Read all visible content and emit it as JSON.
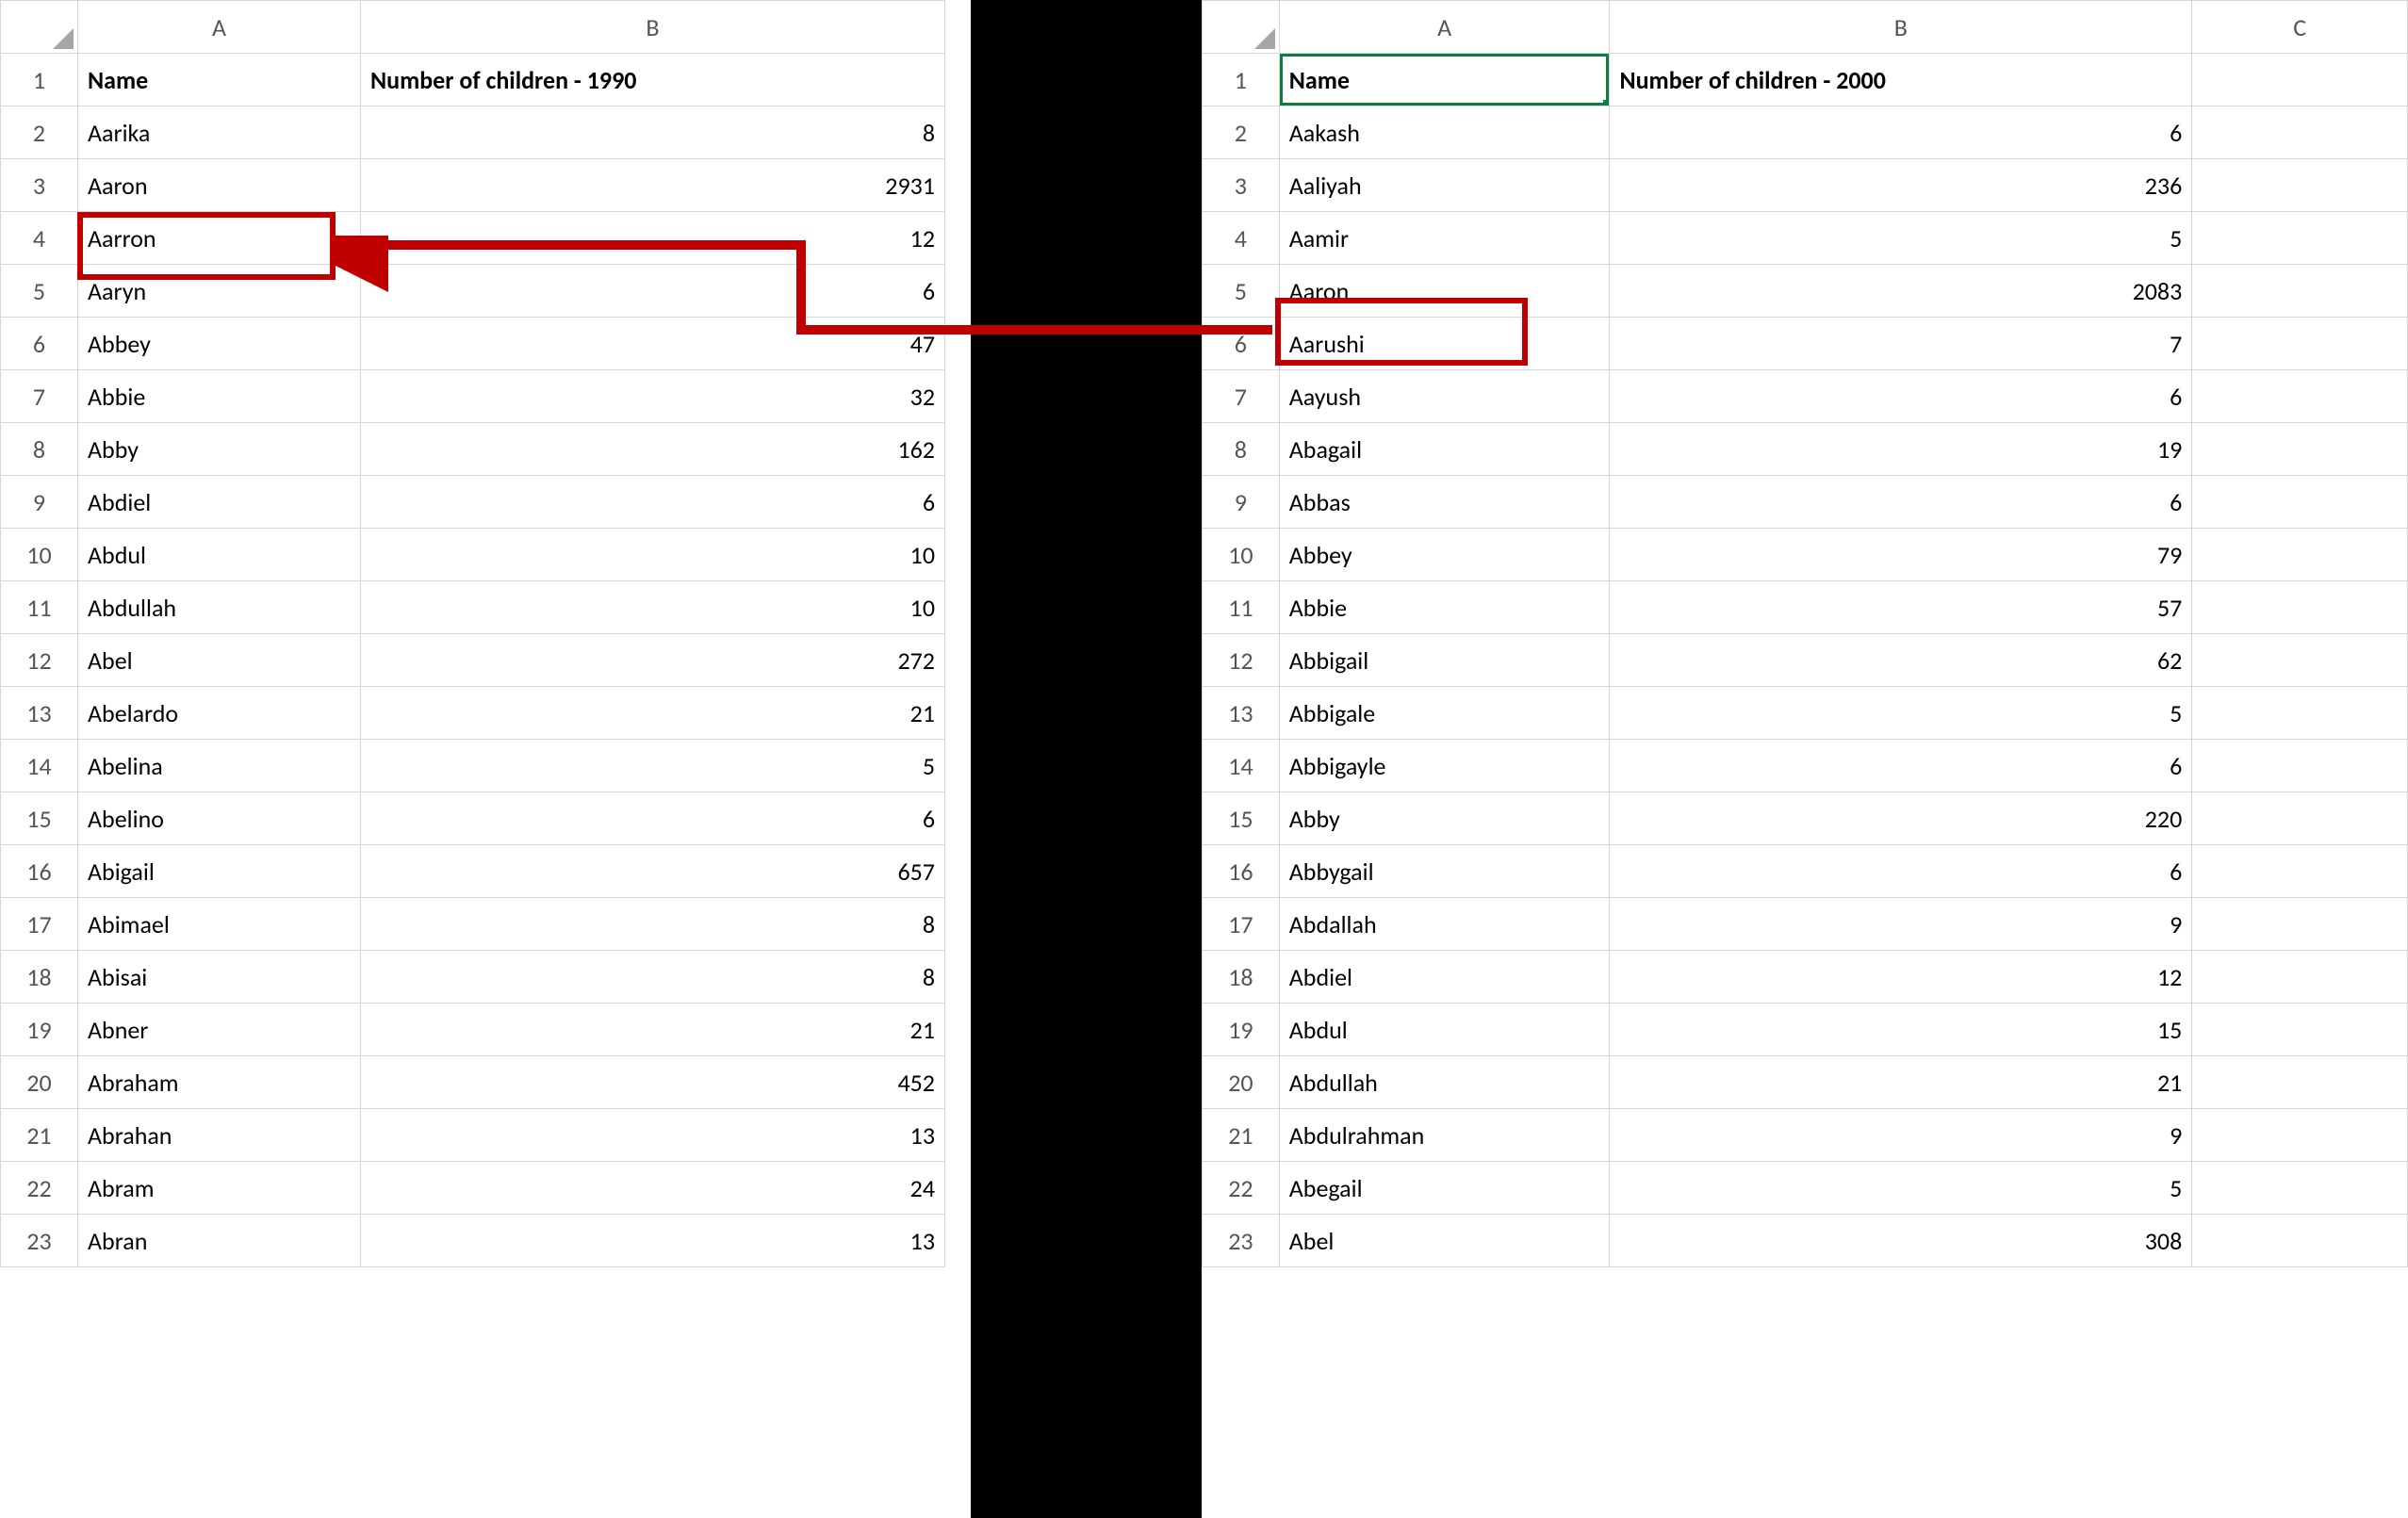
{
  "left": {
    "colLabels": [
      "A",
      "B"
    ],
    "header": {
      "A": "Name",
      "B": "Number of children - 1990"
    },
    "rows": [
      {
        "A": "Aarika",
        "B": "8"
      },
      {
        "A": "Aaron",
        "B": "2931"
      },
      {
        "A": "Aarron",
        "B": "12"
      },
      {
        "A": "Aaryn",
        "B": "6"
      },
      {
        "A": "Abbey",
        "B": "47"
      },
      {
        "A": "Abbie",
        "B": "32"
      },
      {
        "A": "Abby",
        "B": "162"
      },
      {
        "A": "Abdiel",
        "B": "6"
      },
      {
        "A": "Abdul",
        "B": "10"
      },
      {
        "A": "Abdullah",
        "B": "10"
      },
      {
        "A": "Abel",
        "B": "272"
      },
      {
        "A": "Abelardo",
        "B": "21"
      },
      {
        "A": "Abelina",
        "B": "5"
      },
      {
        "A": "Abelino",
        "B": "6"
      },
      {
        "A": "Abigail",
        "B": "657"
      },
      {
        "A": "Abimael",
        "B": "8"
      },
      {
        "A": "Abisai",
        "B": "8"
      },
      {
        "A": "Abner",
        "B": "21"
      },
      {
        "A": "Abraham",
        "B": "452"
      },
      {
        "A": "Abrahan",
        "B": "13"
      },
      {
        "A": "Abram",
        "B": "24"
      },
      {
        "A": "Abran",
        "B": "13"
      }
    ]
  },
  "right": {
    "colLabels": [
      "A",
      "B",
      "C"
    ],
    "header": {
      "A": "Name",
      "B": "Number of children - 2000",
      "C": ""
    },
    "rows": [
      {
        "A": "Aakash",
        "B": "6"
      },
      {
        "A": "Aaliyah",
        "B": "236"
      },
      {
        "A": "Aamir",
        "B": "5"
      },
      {
        "A": "Aaron",
        "B": "2083"
      },
      {
        "A": "Aarushi",
        "B": "7"
      },
      {
        "A": "Aayush",
        "B": "6"
      },
      {
        "A": "Abagail",
        "B": "19"
      },
      {
        "A": "Abbas",
        "B": "6"
      },
      {
        "A": "Abbey",
        "B": "79"
      },
      {
        "A": "Abbie",
        "B": "57"
      },
      {
        "A": "Abbigail",
        "B": "62"
      },
      {
        "A": "Abbigale",
        "B": "5"
      },
      {
        "A": "Abbigayle",
        "B": "6"
      },
      {
        "A": "Abby",
        "B": "220"
      },
      {
        "A": "Abbygail",
        "B": "6"
      },
      {
        "A": "Abdallah",
        "B": "9"
      },
      {
        "A": "Abdiel",
        "B": "12"
      },
      {
        "A": "Abdul",
        "B": "15"
      },
      {
        "A": "Abdullah",
        "B": "21"
      },
      {
        "A": "Abdulrahman",
        "B": "9"
      },
      {
        "A": "Abegail",
        "B": "5"
      },
      {
        "A": "Abel",
        "B": "308"
      }
    ]
  },
  "highlight_name": "Aaron"
}
